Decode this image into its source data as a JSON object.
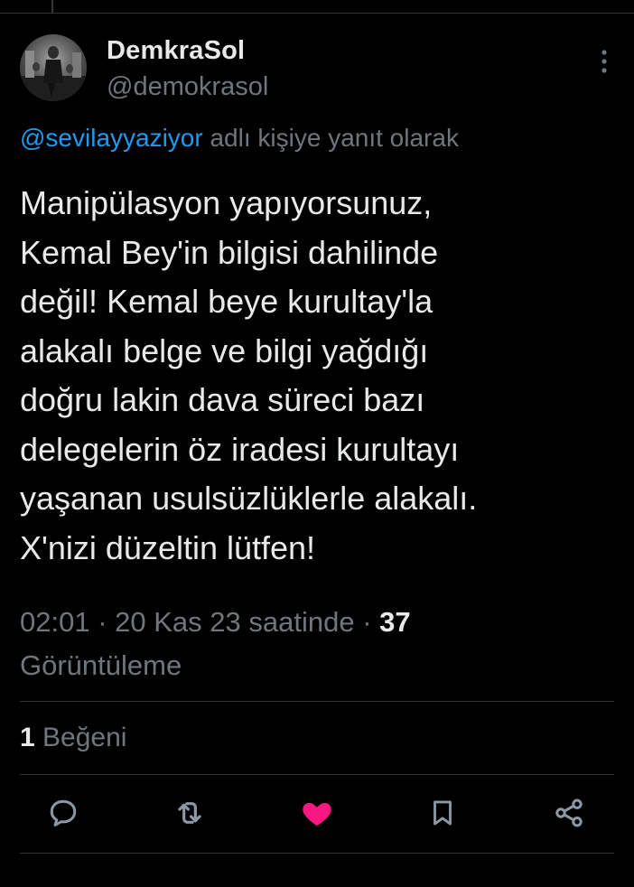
{
  "tweet": {
    "author_name": "DemkraSol",
    "author_handle": "@demokrasol",
    "reply_mention": "@sevilayyaziyor",
    "reply_suffix": " adlı kişiye yanıt olarak",
    "text": "Manipülasyon yapıyorsunuz,\nKemal Bey'in bilgisi dahilinde\ndeğil! Kemal beye kurultay'la\nalakalı belge ve bilgi yağdığı\ndoğru lakin dava süreci bazı\ndelegelerin öz iradesi kurultayı\nyaşanan usulsüzlüklerle alakalı.\nX'nizi düzeltin lütfen!",
    "time": "02:01",
    "separator": " · ",
    "date": "20 Kas 23 saatinde",
    "views_count": "37",
    "views_label": "Görüntüleme",
    "likes_count": "1",
    "likes_label": "Beğeni"
  },
  "actions": {
    "reply_icon": "reply-bubble-icon",
    "retweet_icon": "retweet-icon",
    "like_icon": "heart-filled-icon",
    "bookmark_icon": "bookmark-icon",
    "share_icon": "share-icon"
  },
  "colors": {
    "background": "#000000",
    "text_primary": "#e7e9ea",
    "text_secondary": "#71767b",
    "link": "#1d9bf0",
    "like_active": "#f91880",
    "divider": "#2f3336"
  }
}
